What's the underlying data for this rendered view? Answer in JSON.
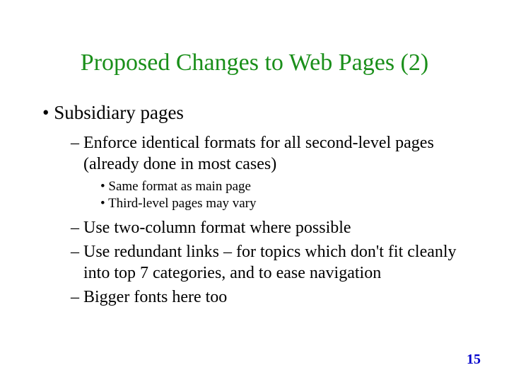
{
  "title": "Proposed Changes to Web Pages (2)",
  "bullets": {
    "l1": "Subsidiary pages",
    "l2a": "Enforce identical formats for all second-level pages (already done in most cases)",
    "l3a": "Same format as main page",
    "l3b": "Third-level pages may vary",
    "l2b": "Use two-column format where possible",
    "l2c": "Use redundant links – for topics which don't fit cleanly into top 7 categories, and to ease navigation",
    "l2d": "Bigger fonts here too"
  },
  "pageNumber": "15"
}
